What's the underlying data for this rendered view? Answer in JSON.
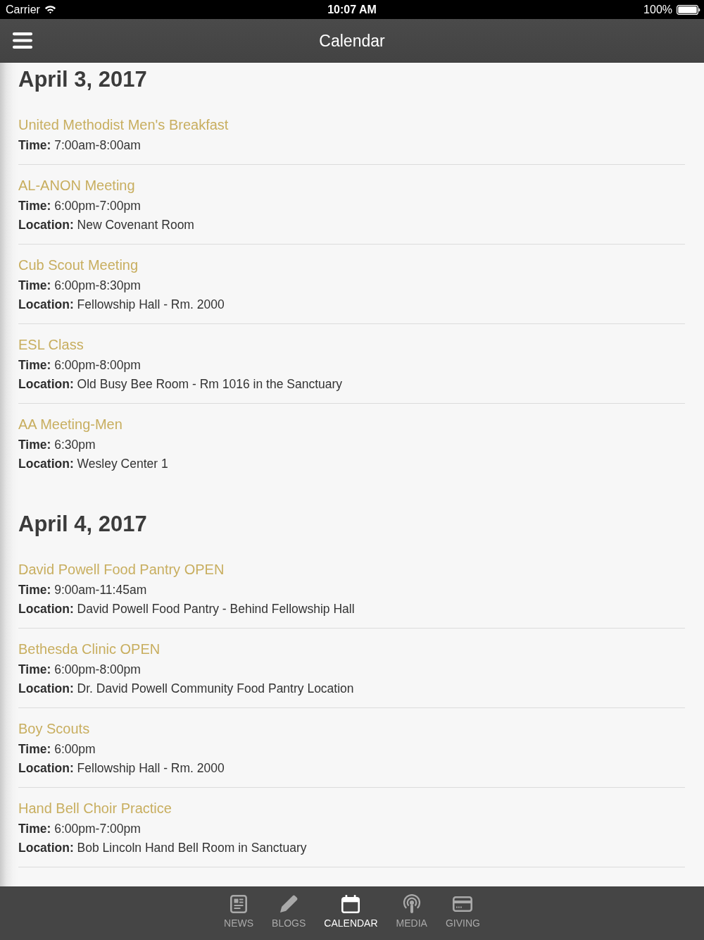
{
  "status_bar": {
    "carrier": "Carrier",
    "time": "10:07 AM",
    "battery": "100%"
  },
  "nav_bar": {
    "title": "Calendar"
  },
  "days": [
    {
      "date": "April 3, 2017",
      "events": [
        {
          "title": "United Methodist Men's Breakfast",
          "details": [
            "**Time:** 7:00am-8:00am"
          ]
        },
        {
          "title": "AL-ANON Meeting",
          "details": [
            "**Time:** 6:00pm-7:00pm",
            "**Location:** New Covenant Room"
          ]
        },
        {
          "title": "Cub Scout Meeting",
          "details": [
            "**Time:** 6:00pm-8:30pm",
            "**Location:** Fellowship Hall - Rm. 2000"
          ]
        },
        {
          "title": "ESL Class",
          "details": [
            "**Time:** 6:00pm-8:00pm",
            "**Location:** Old Busy Bee Room - Rm 1016 in the Sanctuary"
          ]
        },
        {
          "title": "AA Meeting-Men",
          "details": [
            "**Time:** 6:30pm",
            "**Location:** Wesley Center 1"
          ]
        }
      ]
    },
    {
      "date": "April 4, 2017",
      "events": [
        {
          "title": "David Powell Food Pantry OPEN",
          "details": [
            "**Time:** 9:00am-11:45am",
            "**Location:** David Powell Food Pantry - Behind Fellowship Hall"
          ]
        },
        {
          "title": "Bethesda Clinic OPEN",
          "details": [
            "**Time:** 6:00pm-8:00pm",
            "**Location:** Dr. David Powell Community Food Pantry Location"
          ]
        },
        {
          "title": "Boy Scouts",
          "details": [
            "**Time:** 6:00pm",
            "**Location:** Fellowship Hall - Rm. 2000"
          ]
        },
        {
          "title": "Hand Bell Choir Practice",
          "details": [
            "**Time:** 6:00pm-7:00pm",
            "**Location:** Bob Lincoln Hand Bell Room in Sanctuary"
          ]
        }
      ]
    }
  ],
  "tab_bar": {
    "tabs": [
      {
        "label": "NEWS",
        "selected": false
      },
      {
        "label": "BLOGS",
        "selected": false
      },
      {
        "label": "CALENDAR",
        "selected": true
      },
      {
        "label": "MEDIA",
        "selected": false
      },
      {
        "label": "GIVING",
        "selected": false
      }
    ]
  }
}
